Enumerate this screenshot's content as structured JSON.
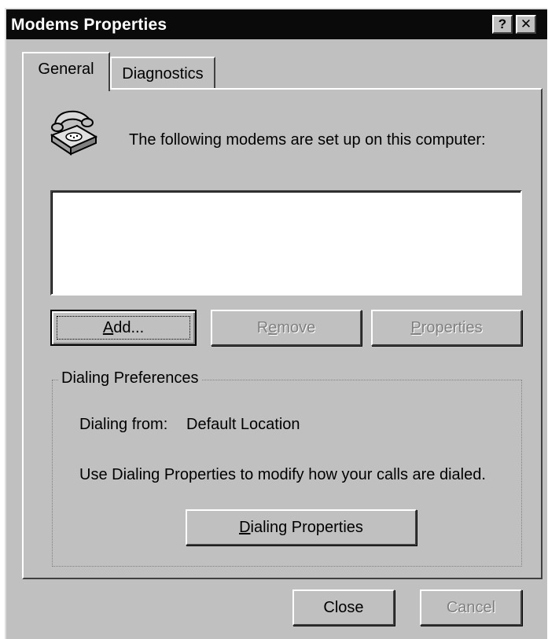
{
  "window": {
    "title": "Modems Properties",
    "help_button": "?",
    "close_button": "✕"
  },
  "tabs": [
    {
      "label": "General",
      "active": true
    },
    {
      "label": "Diagnostics",
      "active": false
    }
  ],
  "general": {
    "intro_text": "The following modems are set up on this computer:",
    "modems": [],
    "buttons": {
      "add": {
        "pre": "",
        "accel": "A",
        "post": "dd..."
      },
      "remove": {
        "pre": "R",
        "accel": "e",
        "post": "move"
      },
      "properties": {
        "pre": "",
        "accel": "P",
        "post": "roperties"
      }
    },
    "dialing_preferences": {
      "legend": "Dialing Preferences",
      "dialing_from_label": "Dialing from:",
      "dialing_from_value": "Default Location",
      "info": "Use Dialing Properties to modify how your calls are dialed.",
      "button": {
        "pre": "",
        "accel": "D",
        "post": "ialing Properties"
      }
    }
  },
  "footer": {
    "close_label": "Close",
    "cancel_label": "Cancel"
  },
  "icons": {
    "phone": "telephone-icon"
  },
  "colors": {
    "face": "#c0c0c0",
    "titlebar": "#0a0a0a",
    "disabled_text": "#808080"
  }
}
